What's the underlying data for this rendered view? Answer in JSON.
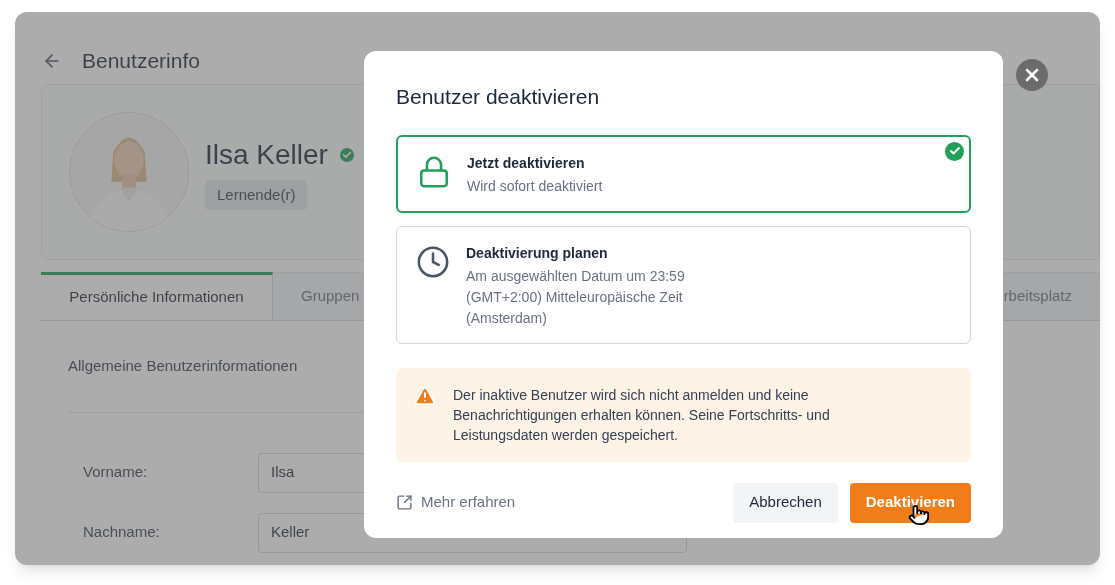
{
  "page": {
    "title": "Benutzerinfo"
  },
  "profile": {
    "name": "Ilsa Keller",
    "verified": true,
    "role": "Lernende(r)"
  },
  "tabs": [
    {
      "label": "Persönliche Informationen",
      "selected": true
    },
    {
      "label": "Gruppen",
      "selected": false
    },
    {
      "label": "rbeitsplatz",
      "selected": false
    }
  ],
  "section": {
    "title": "Allgemeine Benutzerinformationen"
  },
  "fields": [
    {
      "label": "Vorname:",
      "value": "Ilsa"
    },
    {
      "label": "Nachname:",
      "value": "Keller"
    }
  ],
  "dialog": {
    "title": "Benutzer deaktivieren",
    "options": [
      {
        "kind": "lock",
        "title": "Jetzt deaktivieren",
        "lines": [
          "Wird sofort deaktiviert"
        ],
        "selected": true
      },
      {
        "kind": "clock",
        "title": "Deaktivierung planen",
        "lines": [
          "Am ausgewählten Datum um 23:59",
          "(GMT+2:00) Mitteleuropäische Zeit",
          "(Amsterdam)"
        ],
        "selected": false
      }
    ],
    "warning": "Der inaktive Benutzer wird sich nicht anmelden und keine Benachrichtigungen erhalten können. Seine Fortschritts- und Leistungsdaten werden gespeichert.",
    "link": "Mehr erfahren",
    "buttons": [
      {
        "kind": "secondary",
        "label": "Abbrechen"
      },
      {
        "kind": "primary",
        "label": "Deaktivieren"
      }
    ]
  }
}
